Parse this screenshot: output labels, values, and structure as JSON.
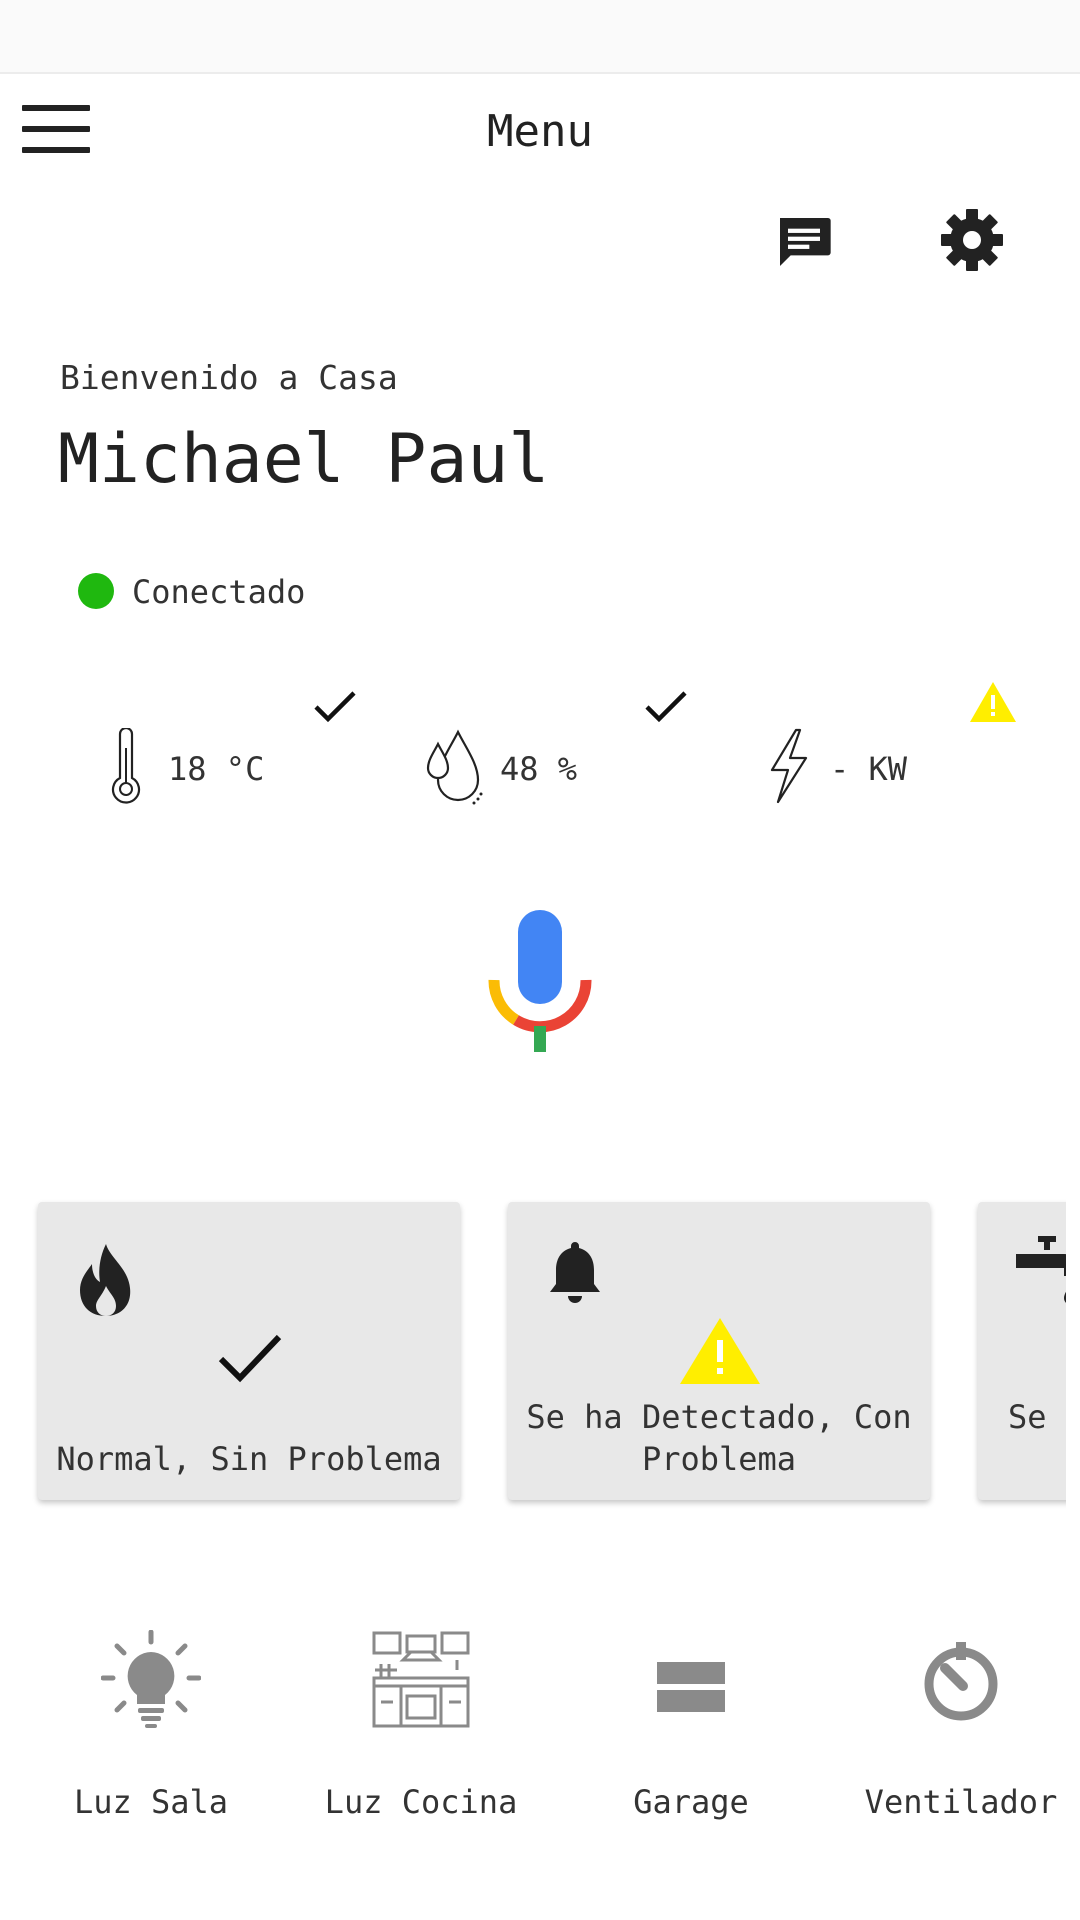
{
  "header": {
    "title": "Menu",
    "menu_icon": "hamburger-menu-icon",
    "chat_icon": "chat-icon",
    "settings_icon": "gear-icon"
  },
  "welcome": {
    "greeting": "Bienvenido a Casa",
    "user_name": "Michael Paul"
  },
  "connection": {
    "status": "Conectado",
    "status_color": "#1fb80f"
  },
  "sensors": [
    {
      "icon": "thermometer-icon",
      "value": "18 °C",
      "status_icon": "check-icon"
    },
    {
      "icon": "humidity-drop-icon",
      "value": "48 %",
      "status_icon": "check-icon"
    },
    {
      "icon": "lightning-icon",
      "value": "- KW",
      "status_icon": "warning-icon"
    }
  ],
  "voice": {
    "icon": "microphone-icon",
    "colors": {
      "blue": "#4285f4",
      "red": "#ea4335",
      "yellow": "#fbbc05",
      "green": "#34a853"
    }
  },
  "alerts": [
    {
      "icon": "fire-icon",
      "status_icon": "check-icon",
      "message": "Normal, Sin Problema"
    },
    {
      "icon": "bell-icon",
      "status_icon": "warning-icon",
      "message_line1": "Se ha Detectado, Con",
      "message_line2": "Problema"
    },
    {
      "icon": "water-tap-icon",
      "message": "Se ha Detectado, Con Problema"
    }
  ],
  "devices": [
    {
      "icon": "light-bulb-icon",
      "label": "Luz Sala"
    },
    {
      "icon": "kitchen-icon",
      "label": "Luz Cocina"
    },
    {
      "icon": "garage-icon",
      "label": "Garage"
    },
    {
      "icon": "fan-timer-icon",
      "label": "Ventilador"
    }
  ],
  "colors": {
    "warning": "#ffee00",
    "card_background": "#e8e8e8",
    "icon_gray": "#8a8a8a"
  }
}
